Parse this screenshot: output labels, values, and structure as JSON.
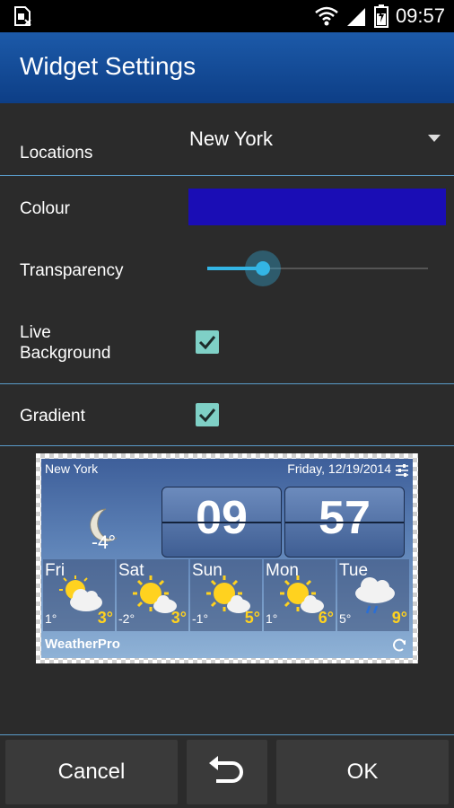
{
  "status_bar": {
    "time": "09:57",
    "icons": [
      "sim-card-icon",
      "wifi-icon",
      "signal-icon",
      "battery-icon"
    ]
  },
  "app_bar": {
    "title": "Widget Settings"
  },
  "settings": {
    "locations": {
      "label": "Locations",
      "value": "New York"
    },
    "colour": {
      "label": "Colour",
      "value": "#1a0db5"
    },
    "transparency": {
      "label": "Transparency",
      "value_fraction": 0.25
    },
    "live_background": {
      "label_line1": "Live",
      "label_line2": "Background",
      "checked": true
    },
    "gradient": {
      "label": "Gradient",
      "checked": true
    }
  },
  "widget_preview": {
    "location": "New York",
    "date": "Friday, 12/19/2014",
    "current_temp": "-4°",
    "clock": {
      "hours": "09",
      "minutes": "57"
    },
    "days": [
      {
        "name": "Fri",
        "low": "1°",
        "high": "3°",
        "icon": "partly-cloudy-icon"
      },
      {
        "name": "Sat",
        "low": "-2°",
        "high": "3°",
        "icon": "sunny-cloud-icon"
      },
      {
        "name": "Sun",
        "low": "-1°",
        "high": "5°",
        "icon": "sunny-cloud-icon"
      },
      {
        "name": "Mon",
        "low": "1°",
        "high": "6°",
        "icon": "sunny-cloud-icon"
      },
      {
        "name": "Tue",
        "low": "5°",
        "high": "9°",
        "icon": "rain-cloud-icon"
      }
    ],
    "brand": "WeatherPro"
  },
  "buttons": {
    "cancel": "Cancel",
    "ok": "OK"
  },
  "colors": {
    "accent": "#33b5e5",
    "app_bar": "#1c5aa9",
    "checkbox": "#7fd0c6",
    "forecast_high": "#ffd21f"
  }
}
